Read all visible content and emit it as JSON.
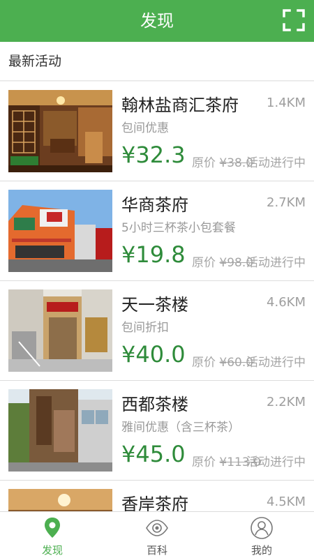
{
  "header": {
    "title": "发现",
    "scan_icon": "scan-icon"
  },
  "section": {
    "title": "最新活动"
  },
  "items": [
    {
      "name": "翰林盐商汇茶府",
      "distance": "1.4KM",
      "desc": "包间优惠",
      "price": "¥32.3",
      "orig_prefix": "原价",
      "orig_price": "¥38.0",
      "status": "活动进行中"
    },
    {
      "name": "华商茶府",
      "distance": "2.7KM",
      "desc": "5小时三杯茶小包套餐",
      "price": "¥19.8",
      "orig_prefix": "原价",
      "orig_price": "¥98.0",
      "status": "活动进行中"
    },
    {
      "name": "天一茶楼",
      "distance": "4.6KM",
      "desc": "包间折扣",
      "price": "¥40.0",
      "orig_prefix": "原价",
      "orig_price": "¥60.0",
      "status": "活动进行中"
    },
    {
      "name": "西都茶楼",
      "distance": "2.2KM",
      "desc": "雅间优惠（含三杯茶）",
      "price": "¥45.0",
      "orig_prefix": "原价",
      "orig_price": "¥113.0",
      "status": "活动进行中"
    },
    {
      "name": "香岸茶府",
      "distance": "4.5KM",
      "desc": "",
      "price": "",
      "orig_prefix": "",
      "orig_price": "",
      "status": ""
    }
  ],
  "tabs": [
    {
      "label": "发现",
      "icon": "location-pin-icon",
      "active": true
    },
    {
      "label": "百科",
      "icon": "eye-icon",
      "active": false
    },
    {
      "label": "我的",
      "icon": "user-icon",
      "active": false
    }
  ],
  "colors": {
    "brand": "#4caf50",
    "price": "#2e8b3a"
  }
}
